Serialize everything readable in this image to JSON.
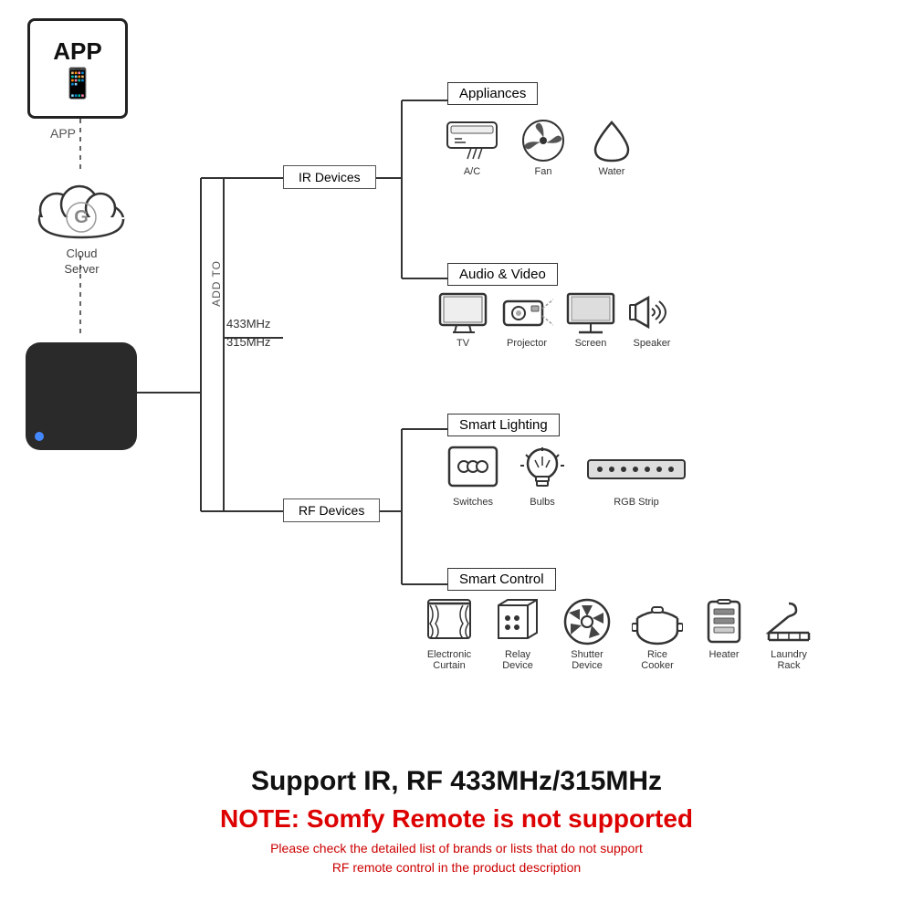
{
  "app": {
    "label": "APP",
    "tablet_icon": "📱"
  },
  "cloud": {
    "label": "Cloud\nServer"
  },
  "device": {
    "type": "smart_hub"
  },
  "connections": {
    "ir_label": "IR Devices",
    "rf_label": "RF Devices",
    "add_to": "433MHz\n315MHz",
    "add_to_prefix": "ADD TO"
  },
  "categories": {
    "appliances": {
      "label": "Appliances",
      "items": [
        {
          "name": "A/C",
          "icon": "ac"
        },
        {
          "name": "Fan",
          "icon": "fan"
        },
        {
          "name": "Water",
          "icon": "water"
        }
      ]
    },
    "audio_video": {
      "label": "Audio & Video",
      "items": [
        {
          "name": "TV",
          "icon": "tv"
        },
        {
          "name": "Projector",
          "icon": "projector"
        },
        {
          "name": "Screen",
          "icon": "screen"
        },
        {
          "name": "Speaker",
          "icon": "speaker"
        }
      ]
    },
    "smart_lighting": {
      "label": "Smart Lighting",
      "items": [
        {
          "name": "Switches",
          "icon": "switch"
        },
        {
          "name": "Bulbs",
          "icon": "bulb"
        },
        {
          "name": "RGB Strip",
          "icon": "rgb"
        }
      ]
    },
    "smart_control": {
      "label": "Smart Control",
      "items": [
        {
          "name": "Electronic\nCurtain",
          "icon": "curtain"
        },
        {
          "name": "Relay\nDevice",
          "icon": "relay"
        },
        {
          "name": "Shutter\nDevice",
          "icon": "shutter"
        },
        {
          "name": "Rice\nCooker",
          "icon": "ricecooker"
        },
        {
          "name": "Heater",
          "icon": "heater"
        },
        {
          "name": "Laundry\nRack",
          "icon": "laundry"
        }
      ]
    }
  },
  "bottom": {
    "support_text": "Support IR, RF 433MHz/315MHz",
    "note_text": "NOTE: Somfy Remote is not supported",
    "sub_text": "Please check the detailed list of brands or lists that do not support\nRF remote control in the product description"
  }
}
